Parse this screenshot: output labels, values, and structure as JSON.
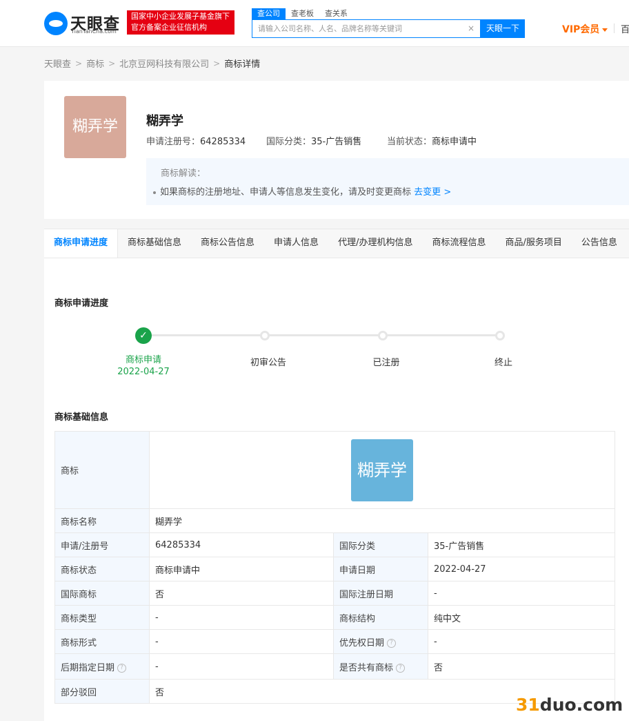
{
  "header": {
    "logo_text": "天眼查",
    "logo_sub": "TianYanCha.com",
    "badge_line1": "国家中小企业发展子基金旗下",
    "badge_line2": "官方备案企业征信机构",
    "search_tabs": [
      "查公司",
      "查老板",
      "查关系"
    ],
    "search_placeholder": "请输入公司名称、人名、品牌名称等关键词",
    "clear_glyph": "×",
    "search_button": "天眼一下",
    "vip": "VIP会员",
    "more": "百"
  },
  "breadcrumb": {
    "items": [
      "天眼查",
      "商标",
      "北京豆网科技有限公司"
    ],
    "current": "商标详情",
    "separator": ">"
  },
  "trademark": {
    "logo_text": "糊弄学",
    "name": "糊弄学",
    "reg_label": "申请注册号：",
    "reg_no": "64285334",
    "class_label": "国际分类：",
    "class_value": "35-广告销售",
    "status_label": "当前状态：",
    "status_value": "商标申请中",
    "interp_title": "商标解读：",
    "interp_text": "如果商标的注册地址、申请人等信息发生变化，请及时变更商标",
    "interp_link": "去变更",
    "interp_link_glyph": ">"
  },
  "tabs": [
    "商标申请进度",
    "商标基础信息",
    "商标公告信息",
    "申请人信息",
    "代理/办理机构信息",
    "商标流程信息",
    "商品/服务项目",
    "公告信息"
  ],
  "progress": {
    "title": "商标申请进度",
    "check_glyph": "✓",
    "steps": [
      {
        "label": "商标申请",
        "date": "2022-04-27",
        "done": true
      },
      {
        "label": "初审公告",
        "done": false
      },
      {
        "label": "已注册",
        "done": false
      },
      {
        "label": "终止",
        "done": false
      }
    ]
  },
  "basic_info": {
    "title": "商标基础信息",
    "help_glyph": "?",
    "logo_label": "商标",
    "logo_text": "糊弄学",
    "name_label": "商标名称",
    "name_value": "糊弄学",
    "rows": [
      {
        "l1": "申请/注册号",
        "v1": "64285334",
        "l2": "国际分类",
        "v2": "35-广告销售"
      },
      {
        "l1": "商标状态",
        "v1": "商标申请中",
        "l2": "申请日期",
        "v2": "2022-04-27"
      },
      {
        "l1": "国际商标",
        "v1": "否",
        "l2": "国际注册日期",
        "v2": "-"
      },
      {
        "l1": "商标类型",
        "v1": "-",
        "l2": "商标结构",
        "v2": "纯中文"
      },
      {
        "l1": "商标形式",
        "v1": "-",
        "l2": "优先权日期",
        "v2": "-"
      },
      {
        "l1": "后期指定日期",
        "v1": "-",
        "l2": "是否共有商标",
        "v2": "否"
      }
    ],
    "last_label": "部分驳回",
    "last_value": "否"
  },
  "watermark": {
    "num": "31",
    "rest": "duo.com"
  },
  "colors": {
    "brand": "#0084ff",
    "done": "#1aa34a",
    "badge": "#e50012",
    "vip": "#ff6a00"
  }
}
